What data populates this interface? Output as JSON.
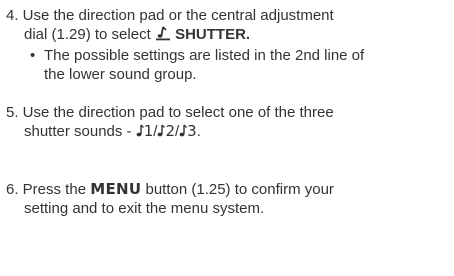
{
  "steps": [
    {
      "line1": "4. Use the direction pad or the central adjustment",
      "line2_pre": "dial (1.29) to select ",
      "line2_bold": "SHUTTER.",
      "bullet_symbol": "•",
      "bullet_line1": "The possible settings are listed in the 2nd line of",
      "bullet_line2": "the lower sound group."
    },
    {
      "line1": "5. Use the direction pad to select one of the three",
      "line2_pre": "shutter sounds - ",
      "sound1": "1",
      "sep1": "/",
      "sound2": "2",
      "sep2": "/",
      "sound3": "3",
      "line2_end": "."
    },
    {
      "line1_pre": "6. Press the ",
      "menu_word": "MENU",
      "line1_post": " button (1.25) to confirm your",
      "line2": "setting and to exit the menu system."
    }
  ],
  "icons": [
    "shutter-sound-icon",
    "note-icon"
  ],
  "colors": {
    "text": "#333333",
    "background": "#ffffff"
  }
}
